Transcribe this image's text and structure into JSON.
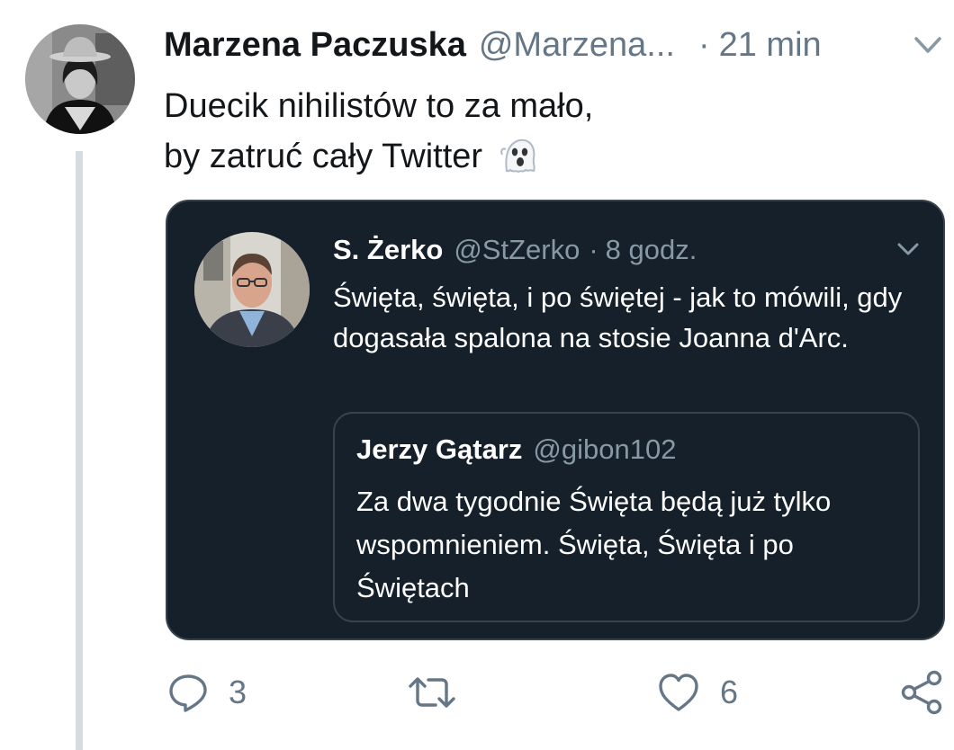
{
  "tweet": {
    "author_name": "Marzena Paczuska",
    "author_handle": "@Marzena...",
    "separator": "·",
    "time": "21 min",
    "text_line1": "Duecik nihilistów to za mało,",
    "text_line2": "by zatruć cały Twitter",
    "emoji_icon": "ghost-icon"
  },
  "quoted_tweet": {
    "author_name": "S. Żerko",
    "author_handle": "@StZerko",
    "separator": "·",
    "time": "8 godz.",
    "text": "Święta, święta, i po świętej - jak to mówili, gdy dogasała spalona na stosie Joanna d'Arc.",
    "nested_quote": {
      "author_name": "Jerzy Gątarz",
      "author_handle": "@gibon102",
      "text": "Za dwa tygodnie Święta będą już tylko wspomnieniem. Święta, Święta i po Świętach"
    }
  },
  "actions": {
    "reply_count": "3",
    "retweet_count": "",
    "like_count": "6"
  },
  "colors": {
    "text_primary": "#14171a",
    "text_secondary": "#657786",
    "thread_line": "#d5dce2",
    "quote_background": "#15202b",
    "quote_border": "#38444d"
  }
}
